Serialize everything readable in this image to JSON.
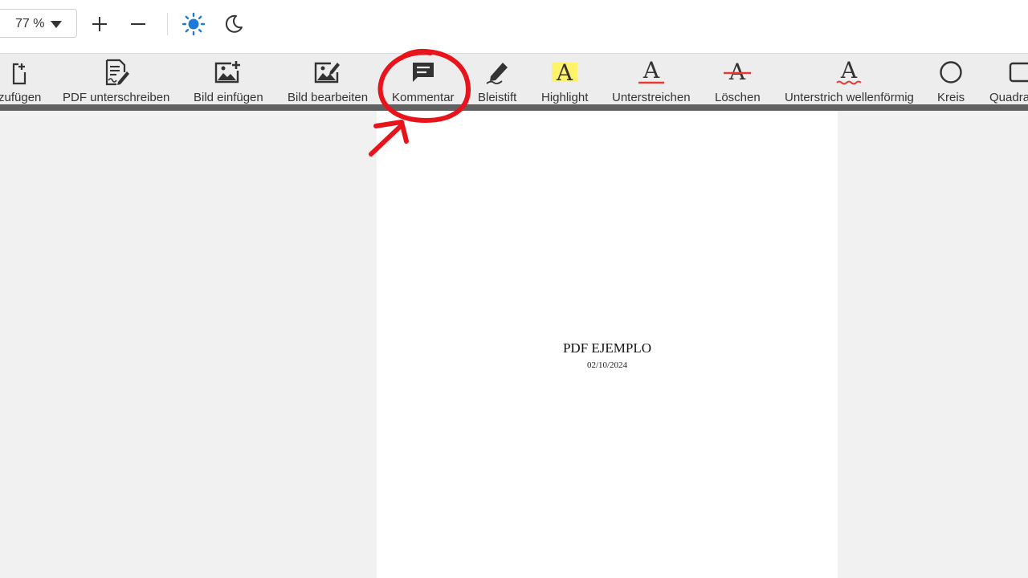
{
  "zoom": {
    "value": "77 %"
  },
  "icons": {
    "zoom_in": "plus-icon",
    "zoom_out": "minus-icon",
    "light_mode": "sun-icon",
    "dark_mode": "moon-icon"
  },
  "colors": {
    "accent": "#1e7ad6",
    "annotation": "#e8141c",
    "toolbar_bg": "#ededed",
    "highlight": "#fff36b",
    "strike_red": "#e53935"
  },
  "toolbar": {
    "tools": [
      {
        "id": "add",
        "label": "zufügen",
        "icon": "add-page-icon"
      },
      {
        "id": "sign",
        "label": "PDF unterschreiben",
        "icon": "sign-document-icon"
      },
      {
        "id": "insert-image",
        "label": "Bild einfügen",
        "icon": "image-add-icon"
      },
      {
        "id": "edit-image",
        "label": "Bild bearbeiten",
        "icon": "image-edit-icon"
      },
      {
        "id": "comment",
        "label": "Kommentar",
        "icon": "comment-icon"
      },
      {
        "id": "pencil",
        "label": "Bleistift",
        "icon": "pencil-icon"
      },
      {
        "id": "highlight",
        "label": "Highlight",
        "icon": "highlight-icon"
      },
      {
        "id": "underline",
        "label": "Unterstreichen",
        "icon": "underline-icon"
      },
      {
        "id": "strikeout",
        "label": "Löschen",
        "icon": "strikeout-icon"
      },
      {
        "id": "squiggly",
        "label": "Unterstrich wellenförmig",
        "icon": "squiggly-underline-icon"
      },
      {
        "id": "circle",
        "label": "Kreis",
        "icon": "circle-icon"
      },
      {
        "id": "square",
        "label": "Quadra",
        "icon": "square-icon"
      }
    ]
  },
  "document": {
    "title": "PDF EJEMPLO",
    "date": "02/10/2024"
  }
}
